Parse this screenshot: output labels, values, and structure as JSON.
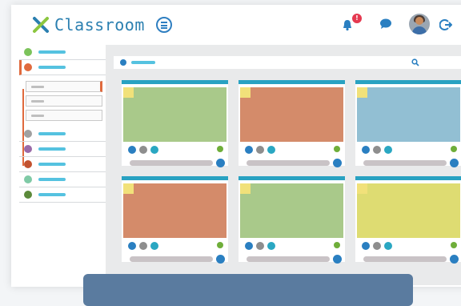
{
  "app": {
    "title": "Classroom"
  },
  "header": {
    "notification_count": "!"
  },
  "colors": {
    "brand_blue": "#2a7fb0",
    "accent_cyan": "#55c2e0",
    "active_orange": "#e06a3d",
    "thumb_green": "#a9c98a",
    "thumb_orange": "#d48b6a",
    "thumb_blue": "#92bfd3",
    "thumb_yellow": "#dedc72"
  },
  "sidebar": {
    "items": [
      {
        "dot_color": "#7cc35b",
        "active": false
      },
      {
        "dot_color": "#e06a3d",
        "active": true
      },
      {
        "dot_color": "#a0a0a0",
        "active": false
      },
      {
        "dot_color": "#9a6aa8",
        "active": false
      },
      {
        "dot_color": "#c2522f",
        "active": false
      },
      {
        "dot_color": "#7fcaa6",
        "active": false
      },
      {
        "dot_color": "#5b8a3a",
        "active": false
      }
    ]
  },
  "cards": [
    {
      "thumb_color": "#a9c98a"
    },
    {
      "thumb_color": "#d48b6a"
    },
    {
      "thumb_color": "#92bfd3"
    },
    {
      "thumb_color": "#d48b6a"
    },
    {
      "thumb_color": "#a9c98a"
    },
    {
      "thumb_color": "#dedc72"
    }
  ],
  "icons": {
    "logo": "x-logo-icon",
    "menu": "menu-icon",
    "bell": "bell-icon",
    "chat": "chat-icon",
    "logout": "logout-icon",
    "search": "search-icon",
    "share": "share-icon",
    "go": "arrow-right-icon"
  }
}
